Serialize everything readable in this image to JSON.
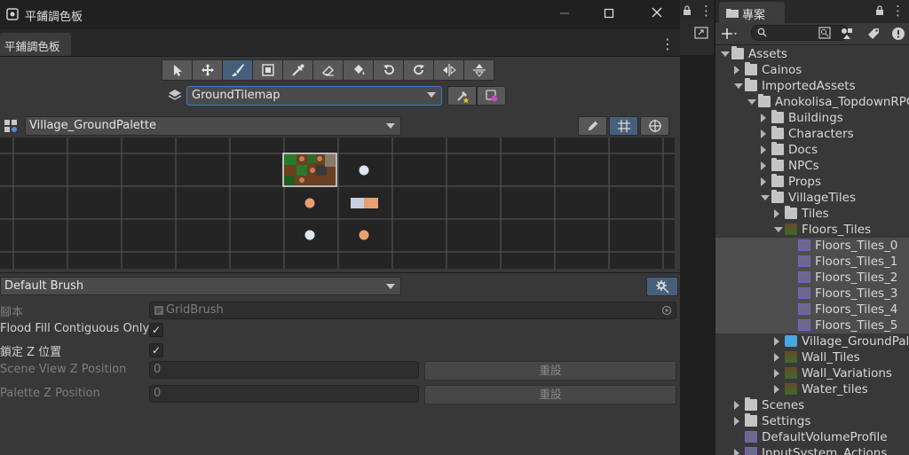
{
  "window": {
    "title": "平鋪調色板",
    "tab_label": "平鋪調色板",
    "controls": [
      "minimize",
      "maximize",
      "close"
    ]
  },
  "toolbar": {
    "tools": [
      {
        "name": "select-tool",
        "icon": "arrow-icon",
        "active": false
      },
      {
        "name": "move-tool",
        "icon": "move-icon",
        "active": false
      },
      {
        "name": "paint-tool",
        "icon": "brush-icon",
        "active": true
      },
      {
        "name": "box-fill-tool",
        "icon": "box-fill-icon",
        "active": false
      },
      {
        "name": "picker-tool",
        "icon": "eyedropper-icon",
        "active": false
      },
      {
        "name": "erase-tool",
        "icon": "eraser-icon",
        "active": false
      },
      {
        "name": "fill-tool",
        "icon": "bucket-icon",
        "active": false
      },
      {
        "name": "rotate-ccw-tool",
        "icon": "rotate-left-icon",
        "active": false
      },
      {
        "name": "rotate-cw-tool",
        "icon": "rotate-right-icon",
        "active": false
      },
      {
        "name": "flip-x-tool",
        "icon": "flip-horizontal-icon",
        "active": false
      },
      {
        "name": "flip-y-tool",
        "icon": "flip-vertical-icon",
        "active": false
      }
    ]
  },
  "target": {
    "selected": "GroundTilemap"
  },
  "palette": {
    "selected": "Village_GroundPalette",
    "grid_columns": 12,
    "grid_rows": 3
  },
  "brush": {
    "selected": "Default Brush",
    "script_label": "腳本",
    "script_value": "GridBrush",
    "flood_fill_label": "Flood Fill Contiguous Only",
    "flood_fill_checked": true,
    "lock_z_label": "鎖定 Z 位置",
    "lock_z_checked": true,
    "scene_z_label": "Scene View Z Position",
    "scene_z_value": "0",
    "palette_z_label": "Palette Z Position",
    "palette_z_value": "0",
    "reset_label": "重設"
  },
  "project": {
    "tab_label": "專案",
    "tree": [
      {
        "label": "Assets",
        "depth": 0,
        "expanded": true,
        "type": "folder"
      },
      {
        "label": "Cainos",
        "depth": 1,
        "expanded": false,
        "type": "folder"
      },
      {
        "label": "ImportedAssets",
        "depth": 1,
        "expanded": true,
        "type": "folder"
      },
      {
        "label": "Anokolisa_TopdownRPG",
        "depth": 2,
        "expanded": true,
        "type": "folder"
      },
      {
        "label": "Buildings",
        "depth": 3,
        "expanded": false,
        "type": "folder"
      },
      {
        "label": "Characters",
        "depth": 3,
        "expanded": false,
        "type": "folder"
      },
      {
        "label": "Docs",
        "depth": 3,
        "expanded": false,
        "type": "folder"
      },
      {
        "label": "NPCs",
        "depth": 3,
        "expanded": false,
        "type": "folder"
      },
      {
        "label": "Props",
        "depth": 3,
        "expanded": false,
        "type": "folder"
      },
      {
        "label": "VillageTiles",
        "depth": 3,
        "expanded": true,
        "type": "folder"
      },
      {
        "label": "Tiles",
        "depth": 4,
        "expanded": false,
        "type": "folder"
      },
      {
        "label": "Floors_Tiles",
        "depth": 4,
        "expanded": true,
        "type": "sheet"
      },
      {
        "label": "Floors_Tiles_0",
        "depth": 5,
        "type": "tile",
        "selected": true
      },
      {
        "label": "Floors_Tiles_1",
        "depth": 5,
        "type": "tile",
        "selected": true
      },
      {
        "label": "Floors_Tiles_2",
        "depth": 5,
        "type": "tile",
        "selected": true
      },
      {
        "label": "Floors_Tiles_3",
        "depth": 5,
        "type": "tile",
        "selected": true
      },
      {
        "label": "Floors_Tiles_4",
        "depth": 5,
        "type": "tile",
        "selected": true
      },
      {
        "label": "Floors_Tiles_5",
        "depth": 5,
        "type": "tile",
        "selected": true
      },
      {
        "label": "Village_GroundPalette",
        "depth": 4,
        "expanded": false,
        "type": "prefab"
      },
      {
        "label": "Wall_Tiles",
        "depth": 4,
        "expanded": false,
        "type": "sheet"
      },
      {
        "label": "Wall_Variations",
        "depth": 4,
        "expanded": false,
        "type": "sheet"
      },
      {
        "label": "Water_tiles",
        "depth": 4,
        "expanded": false,
        "type": "sheet"
      },
      {
        "label": "Scenes",
        "depth": 1,
        "expanded": false,
        "type": "folder"
      },
      {
        "label": "Settings",
        "depth": 1,
        "expanded": false,
        "type": "folder"
      },
      {
        "label": "DefaultVolumeProfile",
        "depth": 1,
        "type": "asset"
      },
      {
        "label": "InputSystem_Actions",
        "depth": 1,
        "expanded": false,
        "type": "asset"
      }
    ]
  }
}
